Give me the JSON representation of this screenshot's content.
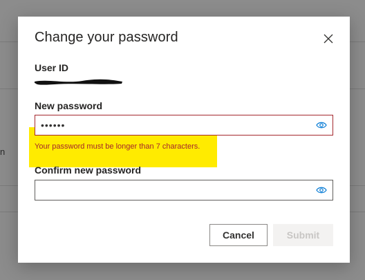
{
  "background": {
    "edge_glyph": "n"
  },
  "dialog": {
    "title": "Change your password",
    "close_icon": "close-icon"
  },
  "user_id": {
    "label": "User ID",
    "value_redacted": true
  },
  "new_password": {
    "label": "New password",
    "value": "••••••",
    "reveal_icon": "eye-icon",
    "error": "Your password must be longer than 7 characters."
  },
  "confirm_password": {
    "label": "Confirm new password",
    "value": "",
    "reveal_icon": "eye-icon"
  },
  "actions": {
    "cancel_label": "Cancel",
    "submit_label": "Submit",
    "submit_enabled": false
  },
  "colors": {
    "error": "#a4262c",
    "accent": "#0078d4",
    "highlight": "#ffeb00",
    "overlay": "#8c8c8c"
  }
}
